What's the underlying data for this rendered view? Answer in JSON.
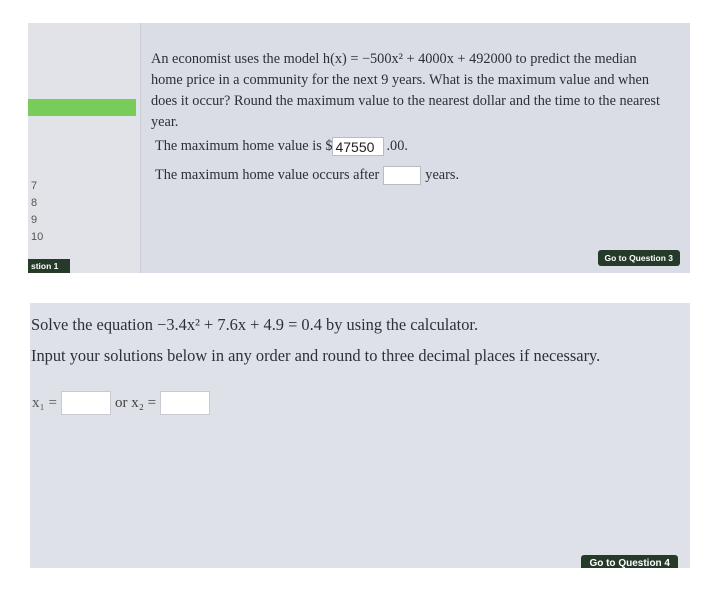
{
  "question2": {
    "line1": "An economist uses the model h(x) = −500x² + 4000x + 492000 to predict the median",
    "line2": "home price in a community for the next 9 years. What is the maximum value and when",
    "line3": "does it occur? Round the maximum value to the nearest dollar and the time to the nearest",
    "line4": "year.",
    "max_value_prefix": "The maximum home value is $",
    "max_value_input": "47550",
    "max_value_suffix": ".00.",
    "occurs_prefix": "The maximum home value occurs after",
    "occurs_input": "",
    "occurs_suffix": "years.",
    "next_button": "Go to Question 3"
  },
  "sidebar": {
    "numbers": [
      "7",
      "8",
      "9",
      "10"
    ],
    "tab_label": "stion 1",
    "progress_color": "#77cc5a"
  },
  "question3": {
    "line1": "Solve the equation −3.4x² + 7.6x + 4.9 = 0.4 by using the calculator.",
    "line2": "Input your solutions below in any order and round to three decimal places if necessary.",
    "x1_label": "x₁ =",
    "or_label": "or x₂ =",
    "x1_value": "",
    "x2_value": "",
    "next_button": "Go to Question 4"
  },
  "colors": {
    "button_bg": "#263a2a",
    "panel_bg": "#dadde6"
  }
}
